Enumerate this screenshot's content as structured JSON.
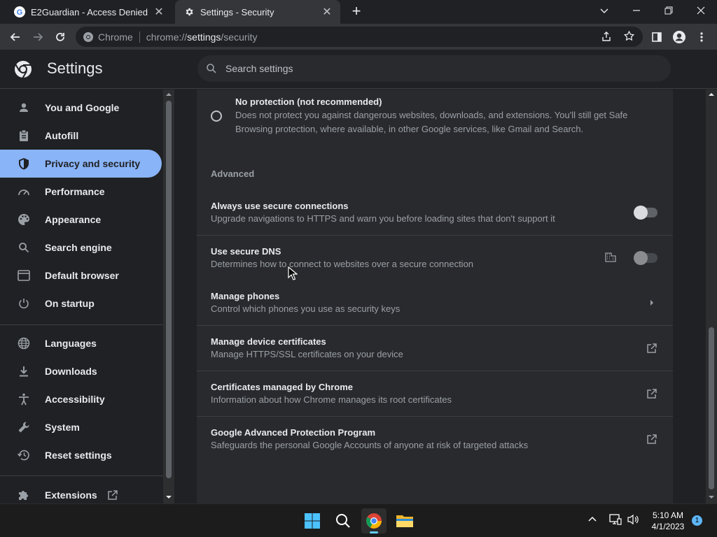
{
  "browser": {
    "tabs": [
      {
        "title": "E2Guardian - Access Denied",
        "active": false
      },
      {
        "title": "Settings - Security",
        "active": true
      }
    ],
    "omnibox": {
      "label": "Chrome",
      "url_scheme": "chrome://",
      "url_host": "settings",
      "url_path": "/security"
    }
  },
  "settings": {
    "app_title": "Settings",
    "search_placeholder": "Search settings"
  },
  "sidebar": {
    "items": [
      {
        "label": "You and Google",
        "icon": "person-icon",
        "active": false
      },
      {
        "label": "Autofill",
        "icon": "clipboard-icon",
        "active": false
      },
      {
        "label": "Privacy and security",
        "icon": "shield-icon",
        "active": true
      },
      {
        "label": "Performance",
        "icon": "speedometer-icon",
        "active": false
      },
      {
        "label": "Appearance",
        "icon": "palette-icon",
        "active": false
      },
      {
        "label": "Search engine",
        "icon": "search-icon",
        "active": false
      },
      {
        "label": "Default browser",
        "icon": "browser-window-icon",
        "active": false
      },
      {
        "label": "On startup",
        "icon": "power-icon",
        "active": false
      },
      {
        "label": "Languages",
        "icon": "globe-icon",
        "active": false
      },
      {
        "label": "Downloads",
        "icon": "download-icon",
        "active": false
      },
      {
        "label": "Accessibility",
        "icon": "accessibility-icon",
        "active": false
      },
      {
        "label": "System",
        "icon": "wrench-icon",
        "active": false
      },
      {
        "label": "Reset settings",
        "icon": "restore-icon",
        "active": false
      },
      {
        "label": "Extensions",
        "icon": "puzzle-icon",
        "active": false
      }
    ]
  },
  "content": {
    "no_protection": {
      "title": "No protection (not recommended)",
      "desc_line1": "Does not protect you against dangerous websites, downloads, and extensions. You'll still get Safe",
      "desc_line2": "Browsing protection, where available, in other Google services, like Gmail and Search.",
      "selected": false
    },
    "advanced_heading": "Advanced",
    "rows": [
      {
        "title": "Always use secure connections",
        "desc": "Upgrade navigations to HTTPS and warn you before loading sites that don't support it",
        "control": "toggle",
        "enabled": false
      },
      {
        "title": "Use secure DNS",
        "desc": "Determines how to connect to websites over a secure connection",
        "control": "toggle",
        "enabled": false,
        "managed": true
      },
      {
        "title": "Manage phones",
        "desc": "Control which phones you use as security keys",
        "control": "arrow"
      },
      {
        "title": "Manage device certificates",
        "desc": "Manage HTTPS/SSL certificates on your device",
        "control": "external"
      },
      {
        "title": "Certificates managed by Chrome",
        "desc": "Information about how Chrome manages its root certificates",
        "control": "external"
      },
      {
        "title": "Google Advanced Protection Program",
        "desc": "Safeguards the personal Google Accounts of anyone at risk of targeted attacks",
        "control": "external"
      }
    ]
  },
  "taskbar": {
    "time": "5:10 AM",
    "date": "4/1/2023",
    "notification_count": "1"
  },
  "colors": {
    "accent": "#8ab4f8",
    "background": "#202124",
    "card": "#292a2d"
  }
}
